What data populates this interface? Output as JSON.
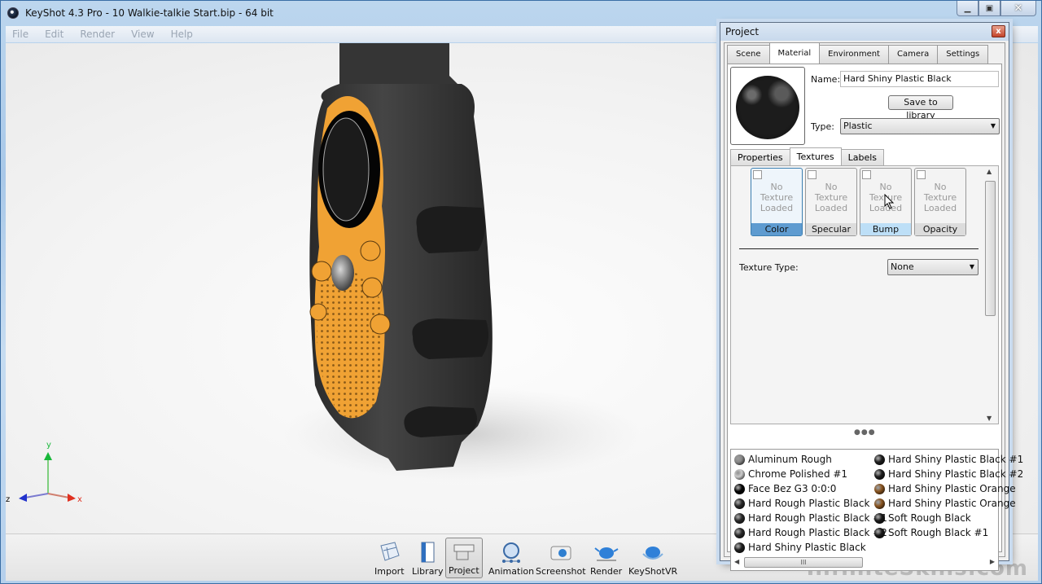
{
  "window": {
    "title": "KeyShot 4.3 Pro  - 10 Walkie-talkie Start.bip  - 64 bit",
    "controls": {
      "minimize": "minimize-icon",
      "maximize": "maximize-icon",
      "close": "close-icon"
    }
  },
  "menu": [
    "File",
    "Edit",
    "Render",
    "View",
    "Help"
  ],
  "viewport": {
    "axis_labels": {
      "x": "x",
      "y": "y",
      "z": "z"
    },
    "watermark": "InfiniteSkills.com",
    "colors": {
      "body": "#3a3a3a",
      "accent": "#f0a234"
    }
  },
  "toolbar": [
    {
      "label": "Import",
      "icon": "import-icon"
    },
    {
      "label": "Library",
      "icon": "library-icon"
    },
    {
      "label": "Project",
      "icon": "project-icon",
      "active": true
    },
    {
      "label": "Animation",
      "icon": "animation-icon"
    },
    {
      "label": "Screenshot",
      "icon": "camera-icon"
    },
    {
      "label": "Render",
      "icon": "render-teapot-icon"
    },
    {
      "label": "KeyShotVR",
      "icon": "keyshotvr-icon"
    }
  ],
  "project": {
    "title": "Project",
    "tabs": [
      "Scene",
      "Material",
      "Environment",
      "Camera",
      "Settings"
    ],
    "active_tab": "Material",
    "material": {
      "name_label": "Name:",
      "name_value": "Hard Shiny Plastic Black",
      "save_button": "Save to library",
      "type_label": "Type:",
      "type_value": "Plastic",
      "subtabs": [
        "Properties",
        "Textures",
        "Labels"
      ],
      "active_subtab": "Textures",
      "texture_slots": [
        {
          "label": "Color",
          "placeholder": "No Texture Loaded",
          "selected": true
        },
        {
          "label": "Specular",
          "placeholder": "No Texture Loaded"
        },
        {
          "label": "Bump",
          "placeholder": "No Texture Loaded",
          "hover": true
        },
        {
          "label": "Opacity",
          "placeholder": "No Texture Loaded"
        }
      ],
      "texture_type_label": "Texture Type:",
      "texture_type_value": "None"
    },
    "material_list": {
      "left": [
        {
          "name": "Aluminum Rough",
          "color": "#888888"
        },
        {
          "name": "Chrome Polished #1",
          "color": "#cccccc"
        },
        {
          "name": "Face Bez G3 0:0:0",
          "color": "#050505"
        },
        {
          "name": "Hard Rough Plastic Black",
          "color": "#2a2a2a"
        },
        {
          "name": "Hard Rough Plastic Black #1",
          "color": "#2a2a2a"
        },
        {
          "name": "Hard Rough Plastic Black #2",
          "color": "#2a2a2a"
        },
        {
          "name": "Hard Shiny Plastic Black",
          "color": "#1e1e1e"
        }
      ],
      "right": [
        {
          "name": "Hard Shiny Plastic Black #1",
          "color": "#1e1e1e"
        },
        {
          "name": "Hard Shiny Plastic Black #2",
          "color": "#1e1e1e"
        },
        {
          "name": "Hard Shiny Plastic Orange",
          "color": "#8a5520"
        },
        {
          "name": "Hard Shiny Plastic Orange",
          "color": "#8a5520"
        },
        {
          "name": "Soft Rough Black",
          "color": "#1a1a1a"
        },
        {
          "name": "Soft Rough Black #1",
          "color": "#1a1a1a"
        }
      ]
    }
  }
}
